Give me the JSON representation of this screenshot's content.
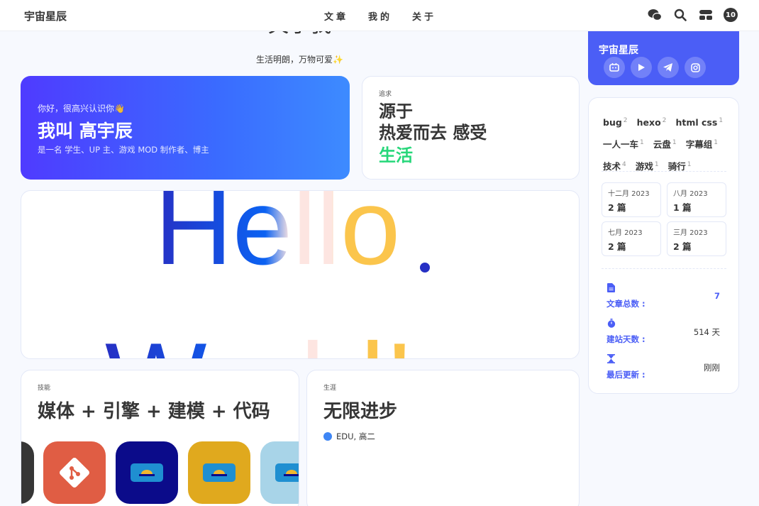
{
  "nav": {
    "brand": "宇宙星辰",
    "menu": [
      "文章",
      "我的",
      "关于"
    ],
    "icons": [
      "wechat-icon",
      "search-icon",
      "toggle-icon"
    ],
    "count": "10"
  },
  "header": {
    "title": "关于我",
    "subtitle": "生活明朗，万物可爱✨"
  },
  "intro": {
    "greeting": "你好，很高兴认识你👋",
    "name": "我叫 高宇辰",
    "description": "是一名 学生、UP 主、游戏 MOD 制作者、博主"
  },
  "pursuit": {
    "label": "追求",
    "line1": "源于",
    "line2": "热爱而去 感受",
    "line3": "生活",
    "accent": "#27d77a"
  },
  "hello": {
    "line1": "Hello",
    "line2": "World!"
  },
  "skills": {
    "label": "技能",
    "title": "媒体 + 引擎 + 建模 + 代码",
    "tiles": [
      {
        "icon": "dark-tile-icon",
        "color": "#363636"
      },
      {
        "icon": "git-icon",
        "color": "#e05d44"
      },
      {
        "icon": "blender-icon",
        "color": "#0b0b8a"
      },
      {
        "icon": "unity-icon",
        "color": "#e0a91e"
      },
      {
        "icon": "cloud-icon",
        "color": "#a8d4e8"
      }
    ]
  },
  "career": {
    "label": "生涯",
    "title": "无限进步",
    "item": "EDU, 高二"
  },
  "author": {
    "name": "宇宙星辰",
    "socials": [
      "bilibili-icon",
      "play-icon",
      "telegram-icon",
      "instagram-icon"
    ],
    "accent": "#4b5ef6"
  },
  "tags": [
    {
      "name": "bug",
      "count": "2"
    },
    {
      "name": "hexo",
      "count": "2"
    },
    {
      "name": "html css",
      "count": "1"
    },
    {
      "name": "一人一车",
      "count": "1"
    },
    {
      "name": "云盘",
      "count": "1"
    },
    {
      "name": "字幕组",
      "count": "1"
    },
    {
      "name": "技术",
      "count": "4"
    },
    {
      "name": "游戏",
      "count": "1"
    },
    {
      "name": "骑行",
      "count": "1"
    }
  ],
  "archives": [
    {
      "month": "十二月 2023",
      "count": "2 篇"
    },
    {
      "month": "八月 2023",
      "count": "1 篇"
    },
    {
      "month": "七月 2023",
      "count": "2 篇"
    },
    {
      "month": "三月 2023",
      "count": "2 篇"
    }
  ],
  "stats": [
    {
      "icon": "file-icon",
      "label": "文章总数 :",
      "value": "7"
    },
    {
      "icon": "stopwatch-icon",
      "label": "建站天数 :",
      "value": "514 天"
    },
    {
      "icon": "hourglass-icon",
      "label": "最后更新 :",
      "value": "刚刚"
    }
  ]
}
